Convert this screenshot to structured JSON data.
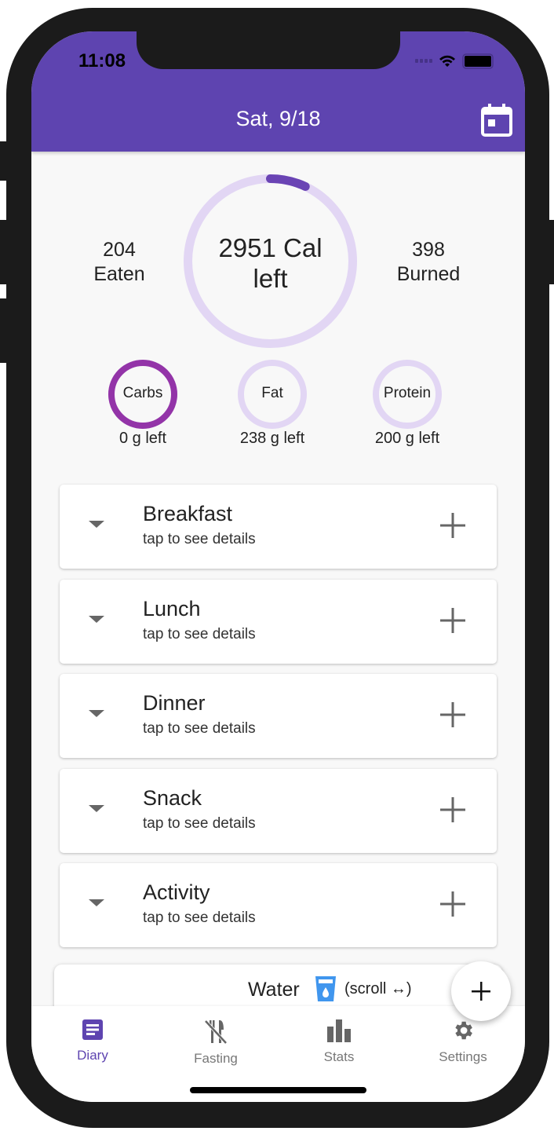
{
  "status_bar": {
    "time": "11:08"
  },
  "header": {
    "title": "Sat, 9/18",
    "calendar_icon": "calendar-icon"
  },
  "summary": {
    "eaten_value": "204",
    "eaten_label": "Eaten",
    "calories_left": "2951 Cal",
    "calories_left_suffix": "left",
    "burned_value": "398",
    "burned_label": "Burned",
    "calorie_progress": 0.07
  },
  "macros": [
    {
      "label": "Carbs",
      "left": "0 g left",
      "progress": 1.0
    },
    {
      "label": "Fat",
      "left": "238 g left",
      "progress": 0
    },
    {
      "label": "Protein",
      "left": "200 g left",
      "progress": 0
    }
  ],
  "meals": [
    {
      "name": "Breakfast",
      "subtitle": "tap to see details"
    },
    {
      "name": "Lunch",
      "subtitle": "tap to see details"
    },
    {
      "name": "Dinner",
      "subtitle": "tap to see details"
    },
    {
      "name": "Snack",
      "subtitle": "tap to see details"
    },
    {
      "name": "Activity",
      "subtitle": "tap to see details"
    }
  ],
  "water": {
    "label": "Water",
    "hint": "(scroll ↔)"
  },
  "nav": [
    {
      "label": "Diary",
      "icon": "diary-icon",
      "active": true
    },
    {
      "label": "Fasting",
      "icon": "no-food-icon"
    },
    {
      "label": "Stats",
      "icon": "bar-chart-icon"
    },
    {
      "label": "Settings",
      "icon": "gear-icon"
    }
  ],
  "colors": {
    "primary": "#5e44b0",
    "ring_track": "#e2d6f4",
    "carbs_ring": "#9334a8",
    "water_icon": "#4096ee"
  }
}
